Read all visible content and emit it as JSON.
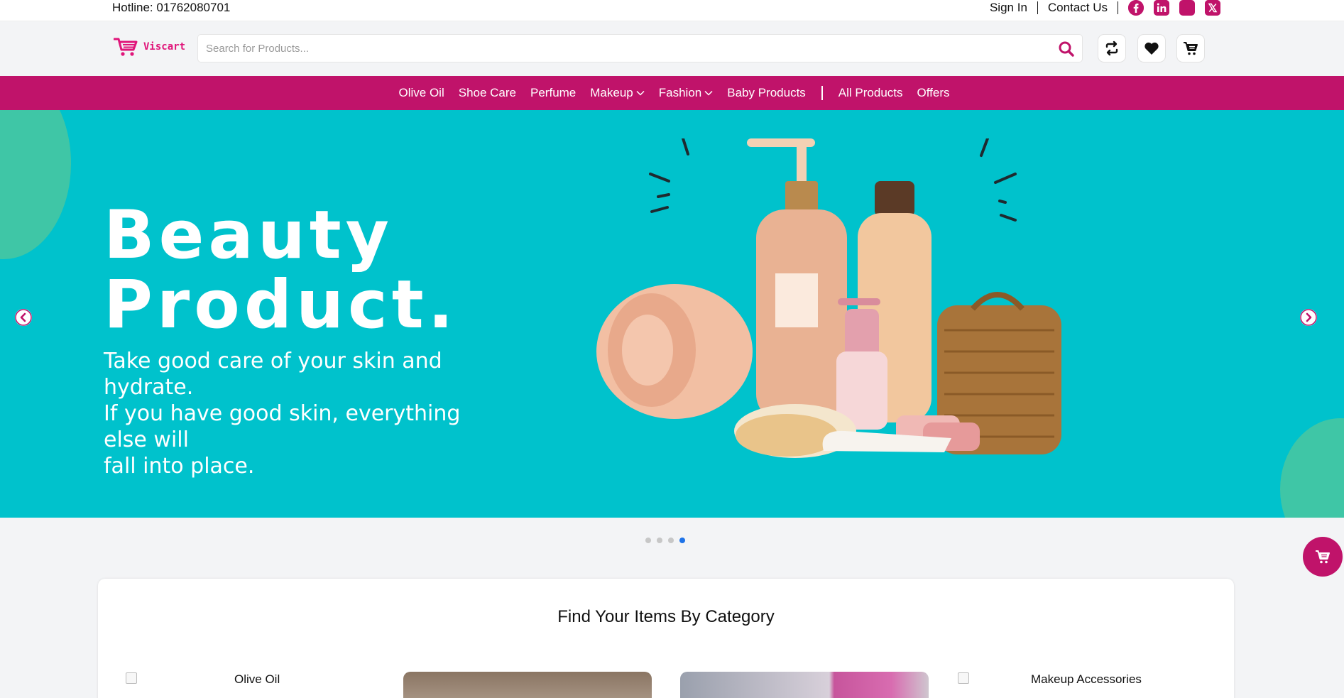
{
  "topbar": {
    "hotline": "Hotline: 01762080701",
    "sign_in": "Sign In",
    "contact_us": "Contact Us",
    "social_icons": [
      "facebook-icon",
      "linkedin-icon",
      "instagram-icon",
      "x-icon"
    ]
  },
  "header": {
    "logo_text": "Viscart",
    "search_placeholder": "Search for Products...",
    "search_value": "",
    "buttons": [
      "compare-icon",
      "heart-icon",
      "cart-icon"
    ]
  },
  "nav": {
    "items": [
      {
        "label": "Olive Oil"
      },
      {
        "label": "Shoe Care"
      },
      {
        "label": "Perfume"
      },
      {
        "label": "Makeup",
        "dropdown": true
      },
      {
        "label": "Fashion",
        "dropdown": true
      },
      {
        "label": "Baby Products"
      }
    ],
    "extra_items": [
      {
        "label": "All Products"
      },
      {
        "label": "Offers"
      }
    ]
  },
  "hero": {
    "title_line1": "Beauty",
    "title_line2": "Product.",
    "subtitle_line1": "Take good care of your skin and hydrate.",
    "subtitle_line2": "If you have good skin, everything else will",
    "subtitle_line3": "fall into place.",
    "slide_count": 4,
    "active_slide": 4
  },
  "categories": {
    "title": "Find Your Items By Category",
    "items": [
      {
        "label": "Olive Oil"
      },
      {
        "label": ""
      },
      {
        "label": ""
      },
      {
        "label": "Makeup Accessories"
      }
    ]
  },
  "colors": {
    "brand": "#c0136a",
    "hero_bg": "#00c2cc",
    "accent_dot": "#1e73e8"
  }
}
